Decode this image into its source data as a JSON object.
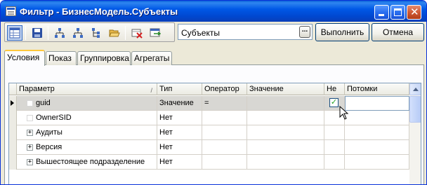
{
  "window": {
    "title": "Фильтр - БизнесМодель.Субъекты"
  },
  "toolbar": {
    "icons": [
      "grid-icon",
      "save-icon",
      "hierarchy-icon",
      "hierarchy-alt-icon",
      "tree-icon",
      "open-folder-icon",
      "delete-icon",
      "apply-icon"
    ],
    "combo_value": "Субъекты",
    "combo_button_label": "...",
    "execute_label": "Выполнить",
    "cancel_label": "Отмена"
  },
  "tabs": [
    {
      "label": "Условия",
      "active": true
    },
    {
      "label": "Показ",
      "active": false
    },
    {
      "label": "Группировка",
      "active": false
    },
    {
      "label": "Агрегаты",
      "active": false
    }
  ],
  "grid": {
    "columns": [
      "Параметр",
      "Тип",
      "Оператор",
      "Значение",
      "Не",
      "Потомки"
    ],
    "sort_mark": "/",
    "rows": [
      {
        "param": "guid",
        "type": "Значение",
        "operator": "=",
        "value": "",
        "not_checked": true,
        "children": "",
        "selected": true,
        "expander": "none"
      },
      {
        "param": "OwnerSID",
        "type": "Нет",
        "operator": "",
        "value": "",
        "not_checked": false,
        "children": "",
        "selected": false,
        "expander": "empty"
      },
      {
        "param": "Аудиты",
        "type": "Нет",
        "operator": "",
        "value": "",
        "not_checked": false,
        "children": "",
        "selected": false,
        "expander": "plus"
      },
      {
        "param": "Версия",
        "type": "Нет",
        "operator": "",
        "value": "",
        "not_checked": false,
        "children": "",
        "selected": false,
        "expander": "plus"
      },
      {
        "param": "Вышестоящее подразделение",
        "type": "Нет",
        "operator": "",
        "value": "",
        "not_checked": false,
        "children": "",
        "selected": false,
        "expander": "plus"
      }
    ]
  },
  "colors": {
    "titlebar": "#0058e6",
    "tab_highlight": "#ffc83c",
    "check_mark": "#21a121"
  }
}
